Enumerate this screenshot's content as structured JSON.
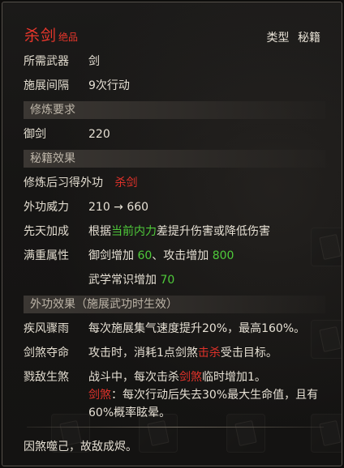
{
  "header": {
    "name": "杀剑",
    "quality": "绝品",
    "type_label": "类型",
    "type_value": "秘籍"
  },
  "basic": {
    "weapon_label": "所需武器",
    "weapon_value": "剑",
    "interval_label": "施展间隔",
    "interval_value": "9次行动"
  },
  "requirements": {
    "title": "修炼要求",
    "skill_label": "御剑",
    "skill_value": "220"
  },
  "manual": {
    "title": "秘籍效果",
    "learn_label": "修炼后习得外功",
    "learn_value": "杀剑",
    "power_label": "外功威力",
    "power_value": "210 → 660",
    "innate_label": "先天加成",
    "innate_pre": "根据",
    "innate_highlight": "当前内力",
    "innate_post": "差提升伤害或降低伤害",
    "full_label": "满重属性",
    "full_a_pre": "御剑增加 ",
    "full_a_val": "60",
    "full_b_pre": "、攻击增加 ",
    "full_b_val": "800",
    "full_c_pre": "武学常识增加 ",
    "full_c_val": "70"
  },
  "effects": {
    "title": "外功效果（施展武功时生效）",
    "items": [
      {
        "name": "疾风骤雨",
        "text": "每次施展集气速度提升20%，最高160%。"
      },
      {
        "name": "剑煞夺命",
        "pre": "攻击时，消耗1点剑煞",
        "highlight": "击杀",
        "post": "受击目标。"
      },
      {
        "name": "戮敌生煞",
        "pre": "战斗中，每次击杀",
        "highlight": "剑煞",
        "post": "临时增加1。",
        "note_highlight": "剑煞",
        "note_text": "：每次行动后失去30%最大生命值，且有",
        "note_text2": "60%概率眩晕。"
      }
    ]
  },
  "flavor": "因煞噬己，故敌成烬。",
  "colors": {
    "red": "#e0322a",
    "green": "#4fca3a",
    "header_bg": "#3b3733"
  }
}
